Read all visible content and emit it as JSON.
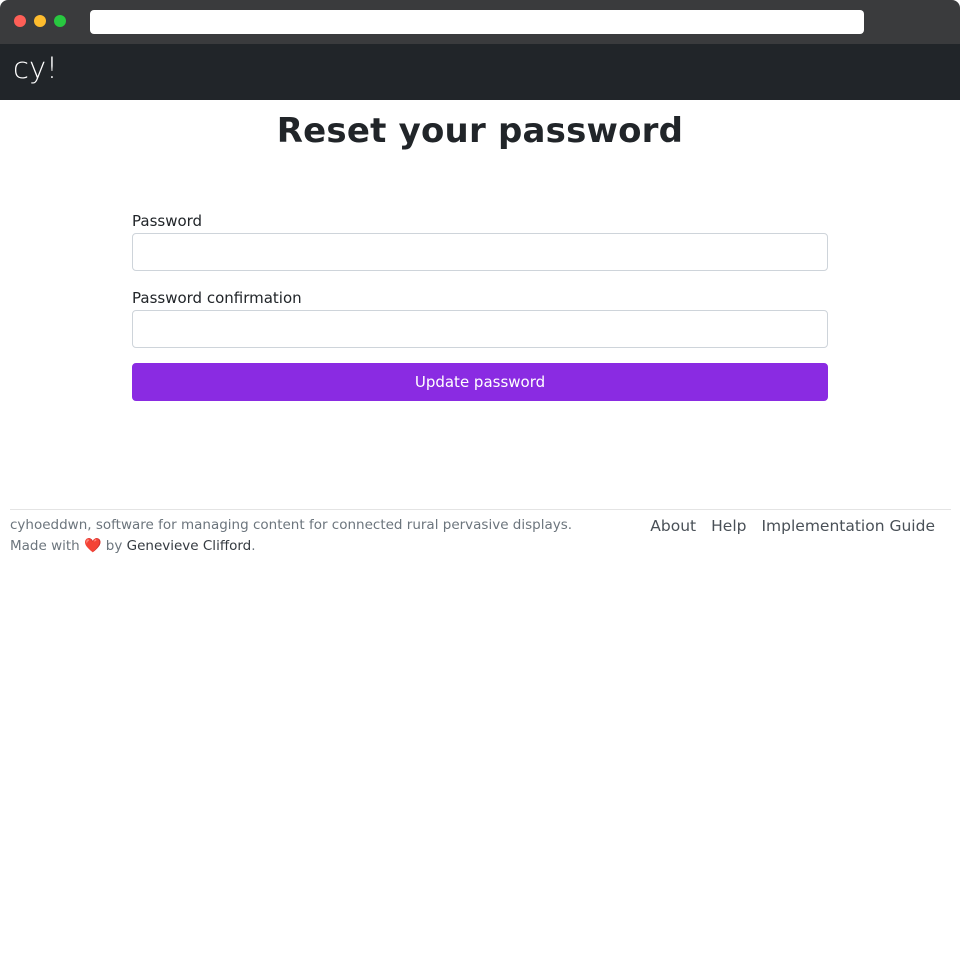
{
  "browser": {
    "address_value": ""
  },
  "navbar": {
    "brand": "cy!"
  },
  "page": {
    "title": "Reset your password"
  },
  "form": {
    "password_label": "Password",
    "password_value": "",
    "confirmation_label": "Password confirmation",
    "confirmation_value": "",
    "submit_label": "Update password"
  },
  "footer": {
    "description": "cyhoeddwn, software for managing content for connected rural pervasive displays.",
    "made_with_prefix": "Made with",
    "heart_glyph": "❤️",
    "by_text": "by",
    "author": "Genevieve Clifford",
    "suffix": ".",
    "links": [
      {
        "label": "About"
      },
      {
        "label": "Help"
      },
      {
        "label": "Implementation Guide"
      }
    ]
  },
  "colors": {
    "navbar_bg": "#212529",
    "primary_button": "#8a2be2",
    "heart": "#d32f2f"
  }
}
